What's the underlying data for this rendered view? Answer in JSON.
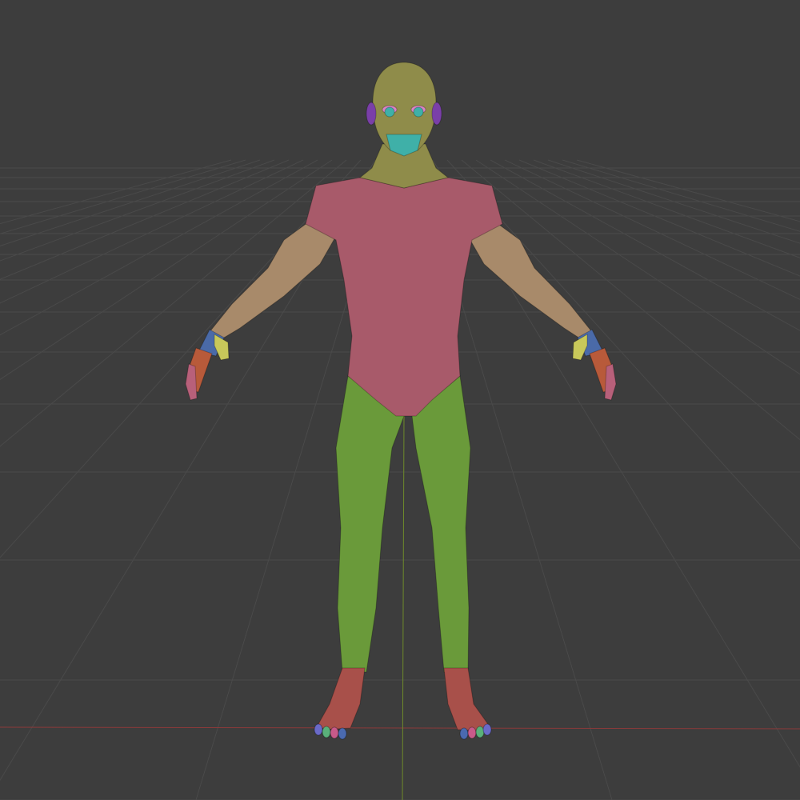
{
  "viewport": {
    "background": "#3d3d3d",
    "grid_color": "#4a4a4a",
    "x_axis_color": "#8a3a3a",
    "y_axis_color": "#6e8a2a",
    "show_grid": true,
    "show_x_axis": true,
    "show_y_axis": true
  },
  "model": {
    "face_set_colors": {
      "head": "#8f8c4a",
      "ears": "#7a3fa8",
      "eyes": "#d985c4",
      "mouth": "#3fb0a8",
      "torso": "#a85a6a",
      "arms": "#a88a6a",
      "wrist": "#4a6aa8",
      "thumb": "#c8c85a",
      "hand": "#b85a3a",
      "fingers": "#b8607a",
      "legs": "#6a9a3a",
      "feet": "#a8504a",
      "toes": [
        "#6a6ac8",
        "#5ab07a",
        "#c85a8a",
        "#4a6ab0"
      ]
    }
  }
}
